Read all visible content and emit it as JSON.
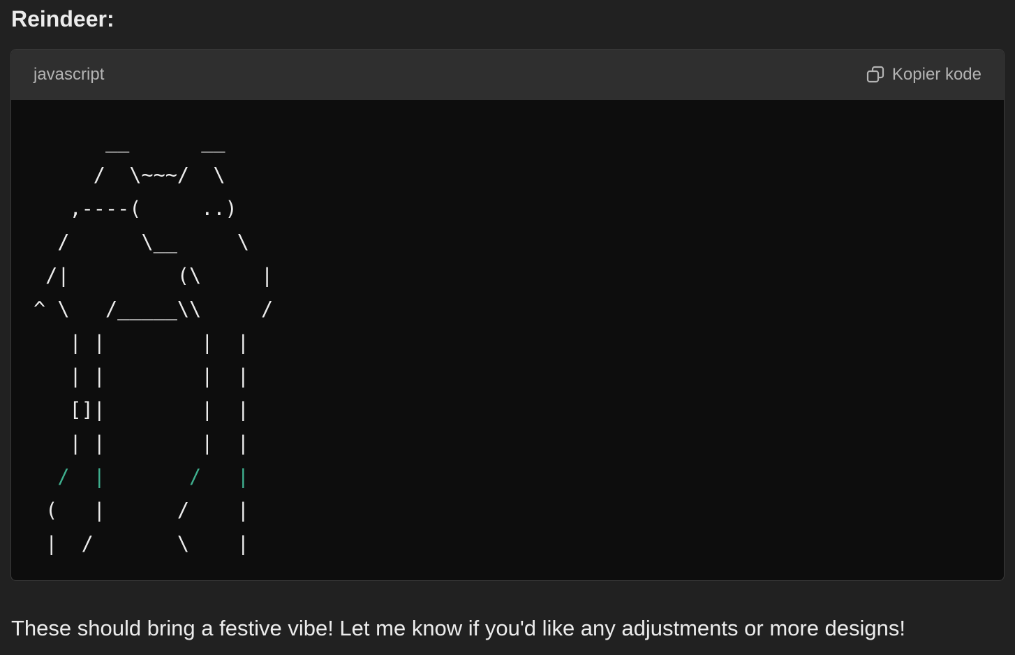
{
  "heading": "Reindeer:",
  "code_block": {
    "language": "javascript",
    "copy_label": "Kopier kode",
    "lines": [
      "      __      __",
      "     /  \\~~~/  \\",
      "   ,----(     ..)",
      "  /      \\__     \\",
      " /|         (\\     |",
      "^ \\   /_____\\\\     /",
      "   | |        |  |",
      "   | |        |  |",
      "   []|        |  |",
      "   | |        |  |",
      "  /  |       /   |",
      " (   |      /    |",
      " |  /       \\    |"
    ],
    "highlighted_line": "  /  |       /   |"
  },
  "footer_text": "These should bring a festive vibe! Let me know if you'd like any adjustments or more designs!",
  "colors": {
    "background": "#212121",
    "code_background": "#0d0d0d",
    "header_background": "#2f2f2f",
    "highlight": "#3fb08f"
  },
  "icons": {
    "copy": "copy-icon"
  }
}
